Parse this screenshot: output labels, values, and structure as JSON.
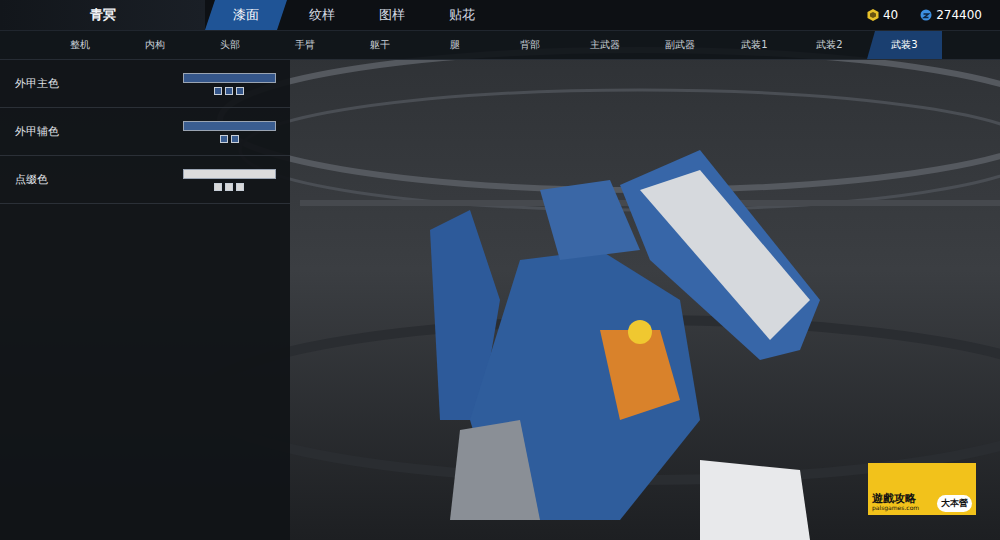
{
  "title": "青冥",
  "tabs": [
    {
      "label": "漆面",
      "selected": true
    },
    {
      "label": "纹样",
      "selected": false
    },
    {
      "label": "图样",
      "selected": false
    },
    {
      "label": "贴花",
      "selected": false
    }
  ],
  "currency": [
    {
      "amount": "40",
      "color": "#e8c12a"
    },
    {
      "amount": "274400",
      "color": "#3d8fe0"
    }
  ],
  "parts": [
    {
      "label": "整机",
      "selected": false
    },
    {
      "label": "内构",
      "selected": false
    },
    {
      "label": "头部",
      "selected": false
    },
    {
      "label": "手臂",
      "selected": false
    },
    {
      "label": "躯干",
      "selected": false
    },
    {
      "label": "腿",
      "selected": false
    },
    {
      "label": "背部",
      "selected": false
    },
    {
      "label": "主武器",
      "selected": false
    },
    {
      "label": "副武器",
      "selected": false
    },
    {
      "label": "武装1",
      "selected": false
    },
    {
      "label": "武装2",
      "selected": false
    },
    {
      "label": "武装3",
      "selected": true
    }
  ],
  "paint_slots": [
    {
      "label": "外甲主色",
      "color": "#35568a",
      "swatches": [
        "#35568a",
        "#35568a",
        "#35568a"
      ]
    },
    {
      "label": "外甲辅色",
      "color": "#3a5d90",
      "swatches": [
        "#3a5d90",
        "#3a5d90"
      ]
    },
    {
      "label": "点缀色",
      "color": "#dcdcdc",
      "swatches": [
        "#d8d8d8",
        "#d8d8d8",
        "#d8d8d8"
      ]
    }
  ],
  "watermark": {
    "title": "遊戲攻略",
    "badge": "大本營",
    "url": "palsgames.com"
  }
}
